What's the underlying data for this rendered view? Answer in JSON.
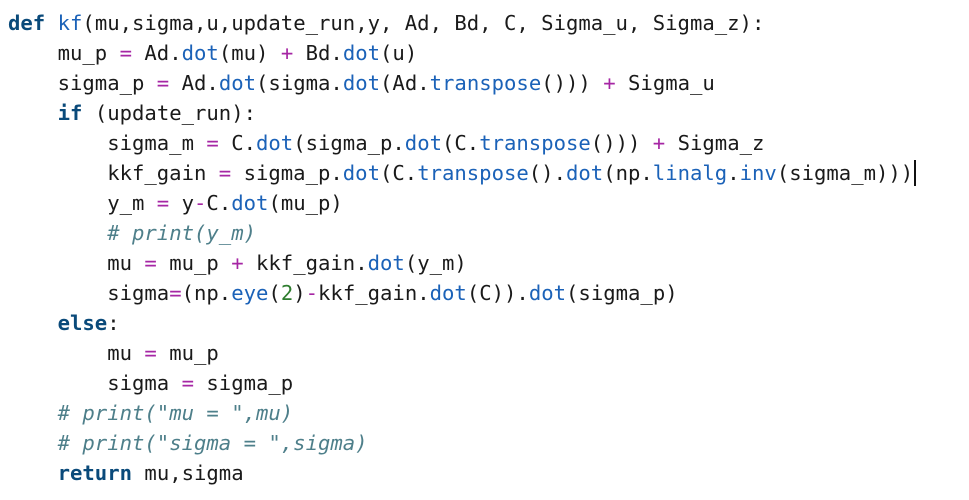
{
  "editor": {
    "lines": [
      [
        {
          "t": "def",
          "c": "kw"
        },
        {
          "t": " ",
          "c": ""
        },
        {
          "t": "kf",
          "c": "fn"
        },
        {
          "t": "(mu,sigma,u,update_run,y, Ad, Bd, C, Sigma_u, Sigma_z):",
          "c": ""
        }
      ],
      [
        {
          "t": "    mu_p ",
          "c": ""
        },
        {
          "t": "=",
          "c": "op"
        },
        {
          "t": " Ad.",
          "c": ""
        },
        {
          "t": "dot",
          "c": "fn"
        },
        {
          "t": "(mu) ",
          "c": ""
        },
        {
          "t": "+",
          "c": "op"
        },
        {
          "t": " Bd.",
          "c": ""
        },
        {
          "t": "dot",
          "c": "fn"
        },
        {
          "t": "(u)",
          "c": ""
        }
      ],
      [
        {
          "t": "    sigma_p ",
          "c": ""
        },
        {
          "t": "=",
          "c": "op"
        },
        {
          "t": " Ad.",
          "c": ""
        },
        {
          "t": "dot",
          "c": "fn"
        },
        {
          "t": "(sigma.",
          "c": ""
        },
        {
          "t": "dot",
          "c": "fn"
        },
        {
          "t": "(Ad.",
          "c": ""
        },
        {
          "t": "transpose",
          "c": "fn"
        },
        {
          "t": "())) ",
          "c": ""
        },
        {
          "t": "+",
          "c": "op"
        },
        {
          "t": " Sigma_u",
          "c": ""
        }
      ],
      [
        {
          "t": "    ",
          "c": ""
        },
        {
          "t": "if",
          "c": "kw"
        },
        {
          "t": " (update_run):",
          "c": ""
        }
      ],
      [
        {
          "t": "        sigma_m ",
          "c": ""
        },
        {
          "t": "=",
          "c": "op"
        },
        {
          "t": " C.",
          "c": ""
        },
        {
          "t": "dot",
          "c": "fn"
        },
        {
          "t": "(sigma_p.",
          "c": ""
        },
        {
          "t": "dot",
          "c": "fn"
        },
        {
          "t": "(C.",
          "c": ""
        },
        {
          "t": "transpose",
          "c": "fn"
        },
        {
          "t": "())) ",
          "c": ""
        },
        {
          "t": "+",
          "c": "op"
        },
        {
          "t": " Sigma_z",
          "c": ""
        }
      ],
      [
        {
          "t": "        kkf_gain ",
          "c": ""
        },
        {
          "t": "=",
          "c": "op"
        },
        {
          "t": " sigma_p.",
          "c": ""
        },
        {
          "t": "dot",
          "c": "fn"
        },
        {
          "t": "(C.",
          "c": ""
        },
        {
          "t": "transpose",
          "c": "fn"
        },
        {
          "t": "().",
          "c": ""
        },
        {
          "t": "dot",
          "c": "fn"
        },
        {
          "t": "(np.",
          "c": ""
        },
        {
          "t": "linalg",
          "c": "fn"
        },
        {
          "t": ".",
          "c": ""
        },
        {
          "t": "inv",
          "c": "fn"
        },
        {
          "t": "(sigma_m)))",
          "c": ""
        },
        {
          "t": "",
          "c": "cursor"
        }
      ],
      [
        {
          "t": "        y_m ",
          "c": ""
        },
        {
          "t": "=",
          "c": "op"
        },
        {
          "t": " y",
          "c": ""
        },
        {
          "t": "-",
          "c": "op"
        },
        {
          "t": "C.",
          "c": ""
        },
        {
          "t": "dot",
          "c": "fn"
        },
        {
          "t": "(mu_p)",
          "c": ""
        }
      ],
      [
        {
          "t": "        ",
          "c": ""
        },
        {
          "t": "# print(y_m)",
          "c": "cmt"
        }
      ],
      [
        {
          "t": "        mu ",
          "c": ""
        },
        {
          "t": "=",
          "c": "op"
        },
        {
          "t": " mu_p ",
          "c": ""
        },
        {
          "t": "+",
          "c": "op"
        },
        {
          "t": " kkf_gain.",
          "c": ""
        },
        {
          "t": "dot",
          "c": "fn"
        },
        {
          "t": "(y_m)",
          "c": ""
        }
      ],
      [
        {
          "t": "        sigma",
          "c": ""
        },
        {
          "t": "=",
          "c": "op"
        },
        {
          "t": "(np.",
          "c": ""
        },
        {
          "t": "eye",
          "c": "fn"
        },
        {
          "t": "(",
          "c": ""
        },
        {
          "t": "2",
          "c": "num"
        },
        {
          "t": ")",
          "c": ""
        },
        {
          "t": "-",
          "c": "op"
        },
        {
          "t": "kkf_gain.",
          "c": ""
        },
        {
          "t": "dot",
          "c": "fn"
        },
        {
          "t": "(C)).",
          "c": ""
        },
        {
          "t": "dot",
          "c": "fn"
        },
        {
          "t": "(sigma_p)",
          "c": ""
        }
      ],
      [
        {
          "t": "    ",
          "c": ""
        },
        {
          "t": "else",
          "c": "kw"
        },
        {
          "t": ":",
          "c": ""
        }
      ],
      [
        {
          "t": "        mu ",
          "c": ""
        },
        {
          "t": "=",
          "c": "op"
        },
        {
          "t": " mu_p",
          "c": ""
        }
      ],
      [
        {
          "t": "        sigma ",
          "c": ""
        },
        {
          "t": "=",
          "c": "op"
        },
        {
          "t": " sigma_p",
          "c": ""
        }
      ],
      [
        {
          "t": "    ",
          "c": ""
        },
        {
          "t": "# print(\"mu = \",mu)",
          "c": "cmt"
        }
      ],
      [
        {
          "t": "    ",
          "c": ""
        },
        {
          "t": "# print(\"sigma = \",sigma)",
          "c": "cmt"
        }
      ],
      [
        {
          "t": "    ",
          "c": ""
        },
        {
          "t": "return",
          "c": "kw"
        },
        {
          "t": " mu,sigma",
          "c": ""
        }
      ]
    ]
  },
  "colors": {
    "keyword": "#0a4a7a",
    "function": "#1b62b8",
    "operator": "#a626a4",
    "number": "#2f7d2f",
    "comment": "#4e7f8a",
    "text": "#1a1a1a",
    "background": "#ffffff"
  }
}
